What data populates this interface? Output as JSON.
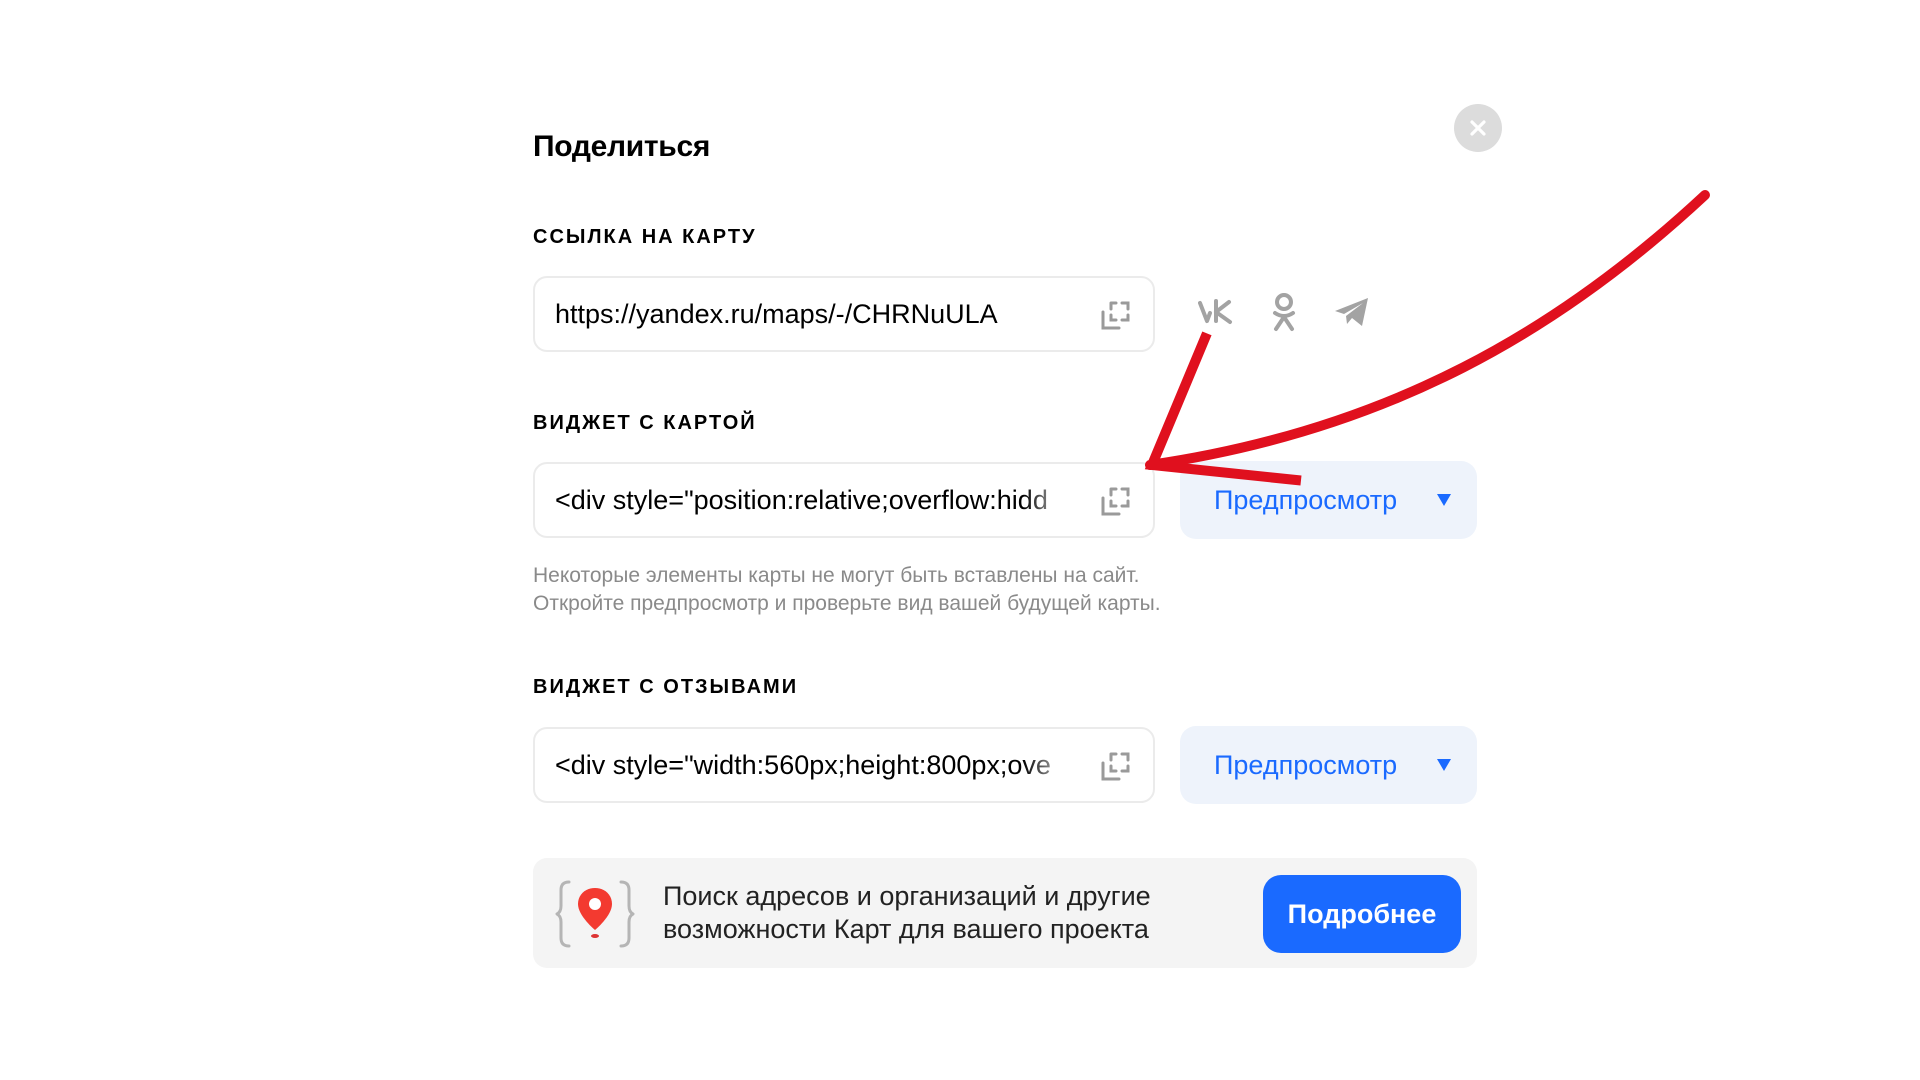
{
  "dialog": {
    "title": "Поделиться",
    "close_icon": "close-icon"
  },
  "link_section": {
    "label": "ССЫЛКА НА КАРТУ",
    "value": "https://yandex.ru/maps/-/CHRNuULA",
    "copy_icon": "copy-icon",
    "social": [
      {
        "name": "vk-icon",
        "glyph": "vk"
      },
      {
        "name": "odnoklassniki-icon",
        "glyph": "ok"
      },
      {
        "name": "telegram-icon",
        "glyph": "tg"
      }
    ]
  },
  "map_widget": {
    "label": "ВИДЖЕТ С КАРТОЙ",
    "value": "<div style=\"position:relative;overflow:hidd",
    "copy_icon": "copy-icon",
    "preview_label": "Предпросмотр",
    "hint_line1": "Некоторые элементы карты не могут быть вставлены на сайт.",
    "hint_line2": "Откройте предпросмотр и проверьте вид вашей будущей карты."
  },
  "reviews_widget": {
    "label": "ВИДЖЕТ С ОТЗЫВАМИ",
    "value": "<div style=\"width:560px;height:800px;ove",
    "copy_icon": "copy-icon",
    "preview_label": "Предпросмотр"
  },
  "promo": {
    "icon": "map-pin-braces-icon",
    "line1": "Поиск адресов и организаций и другие",
    "line2": "возможности Карт для вашего проекта",
    "button_label": "Подробнее"
  },
  "colors": {
    "accent": "#1a6aff",
    "preview_bg": "#eef3fb",
    "hint": "#8a8a8a",
    "annotation_arrow": "#e0101e",
    "pin": "#f33a30"
  }
}
